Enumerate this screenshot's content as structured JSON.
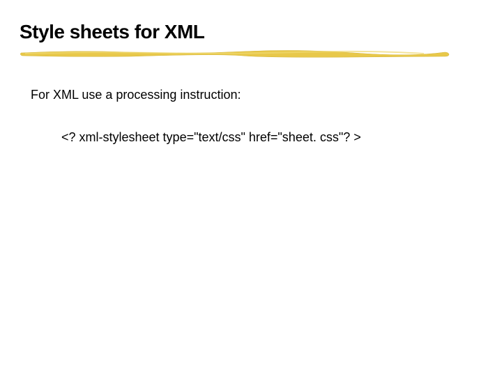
{
  "slide": {
    "title": "Style sheets for XML",
    "intro": "For XML use a processing instruction:",
    "code": "<? xml-stylesheet type=\"text/css\" href=\"sheet. css\"? >"
  }
}
